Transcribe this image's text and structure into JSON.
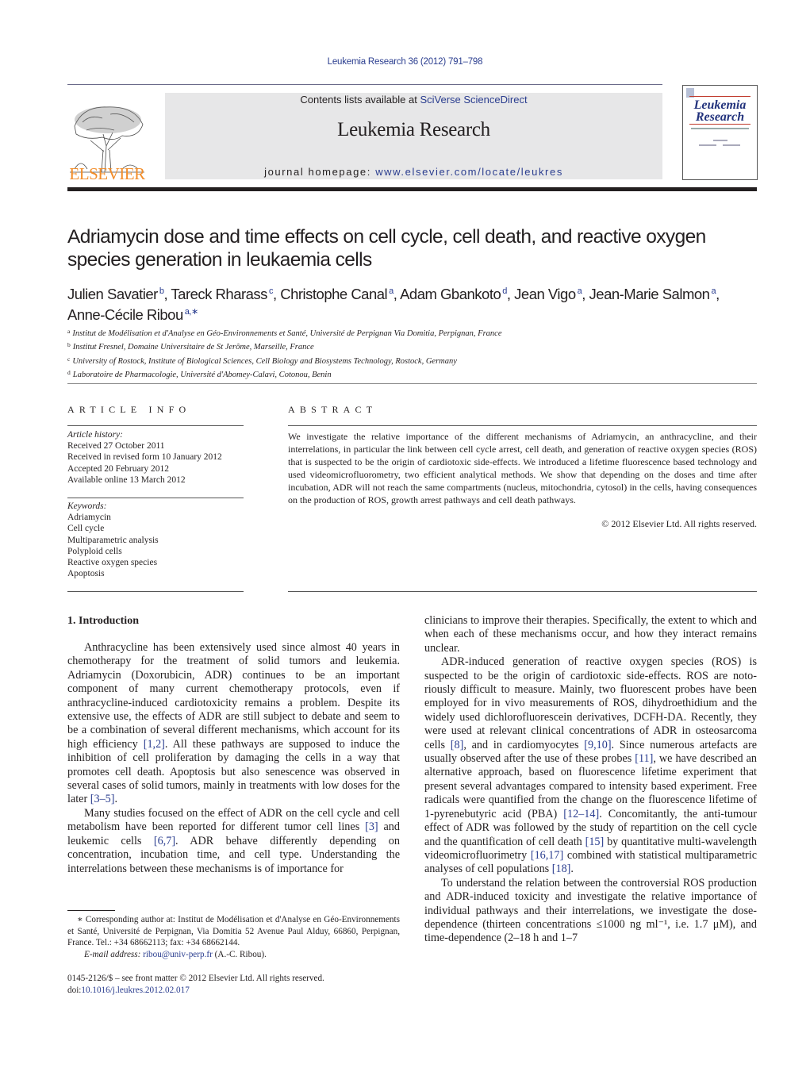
{
  "header": {
    "running_head": "Leukemia Research 36 (2012) 791–798",
    "contents_prefix": "Contents lists available at ",
    "contents_link": "SciVerse ScienceDirect",
    "journal_name": "Leukemia Research",
    "homepage_prefix": "journal homepage: ",
    "homepage_link": "www.elsevier.com/locate/leukres",
    "publisher_logo_text": "ELSEVIER",
    "cover_title_line1": "Leukemia",
    "cover_title_line2": "Research",
    "brand_color": "#f28c28",
    "link_color": "#2a3d8f"
  },
  "article": {
    "title": "Adriamycin dose and time effects on cell cycle, cell death, and reactive oxygen species generation in leukaemia cells",
    "authors": [
      {
        "name": "Julien Savatier",
        "aff": "b",
        "sep": ", "
      },
      {
        "name": "Tareck Rharass",
        "aff": "c",
        "sep": ", "
      },
      {
        "name": "Christophe Canal",
        "aff": "a",
        "sep": ", "
      },
      {
        "name": "Adam Gbankoto",
        "aff": "d",
        "sep": ", "
      },
      {
        "name": "Jean Vigo",
        "aff": "a",
        "sep": ", "
      },
      {
        "name": "Jean-Marie Salmon",
        "aff": "a",
        "sep": ","
      },
      {
        "name": "Anne-Cécile Ribou",
        "aff": "a,∗",
        "sep": ""
      }
    ],
    "affiliations": [
      {
        "key": "a",
        "text": "Institut de Modélisation et d'Analyse en Géo-Environnements et Santé, Université de Perpignan Via Domitia, Perpignan, France"
      },
      {
        "key": "b",
        "text": "Institut Fresnel, Domaine Universitaire de St Jerôme, Marseille, France"
      },
      {
        "key": "c",
        "text": "University of Rostock, Institute of Biological Sciences, Cell Biology and Biosystems Technology, Rostock, Germany"
      },
      {
        "key": "d",
        "text": "Laboratoire de Pharmacologie, Université d'Abomey-Calavi, Cotonou, Benin"
      }
    ]
  },
  "article_info": {
    "heading": "ARTICLE INFO",
    "history_label": "Article history:",
    "history": [
      "Received 27 October 2011",
      "Received in revised form 10 January 2012",
      "Accepted 20 February 2012",
      "Available online 13 March 2012"
    ],
    "keywords_label": "Keywords:",
    "keywords": [
      "Adriamycin",
      "Cell cycle",
      "Multiparametric analysis",
      "Polyploid cells",
      "Reactive oxygen species",
      "Apoptosis"
    ]
  },
  "abstract": {
    "heading": "ABSTRACT",
    "text": "We investigate the relative importance of the different mechanisms of Adriamycin, an anthracycline, and their interrelations, in particular the link between cell cycle arrest, cell death, and generation of reactive oxygen species (ROS) that is suspected to be the origin of cardiotoxic side-effects. We introduced a lifetime fluorescence based technology and used videomicrofluorometry, two efficient analytical methods. We show that depending on the doses and time after incubation, ADR will not reach the same compartments (nucleus, mitochondria, cytosol) in the cells, having consequences on the production of ROS, growth arrest pathways and cell death pathways.",
    "copyright": "© 2012 Elsevier Ltd. All rights reserved."
  },
  "body": {
    "section_heading": "1.  Introduction",
    "left_paragraphs": [
      [
        {
          "t": "Anthracycline has been extensively used since almost 40 years in chemotherapy for the treatment of solid tumors and leukemia. Adriamycin (Doxorubicin, ADR) continues to be an important component of many current chemotherapy protocols, even if anthracycline-induced cardiotoxicity remains a problem. Despite its extensive use, the effects of ADR are still subject to debate and seem to be a combination of several different mechanisms, which account for its high efficiency "
        },
        {
          "r": "[1,2]"
        },
        {
          "t": ". All these pathways are supposed to induce the inhibition of cell proliferation by damaging the cells in a way that promotes cell death. Apoptosis but also senescence was observed in several cases of solid tumors, mainly in treatments with low doses for the later "
        },
        {
          "r": "[3–5]"
        },
        {
          "t": "."
        }
      ],
      [
        {
          "t": "Many studies focused on the effect of ADR on the cell cycle and cell metabolism have been reported for different tumor cell lines "
        },
        {
          "r": "[3]"
        },
        {
          "t": " and leukemic cells "
        },
        {
          "r": "[6,7]"
        },
        {
          "t": ". ADR behave differently depend­ing on concentration, incubation time, and cell type. Understanding the interrelations between these mechanisms is of importance for"
        }
      ]
    ],
    "right_paragraphs": [
      [
        {
          "t": "clinicians to improve their therapies. Specifically, the extent to which and when each of these mechanisms occur, and how they interact remains unclear."
        }
      ],
      [
        {
          "t": "ADR-induced generation of reactive oxygen species (ROS) is suspected to be the origin of cardiotoxic side-effects. ROS are noto­riously difficult to measure. Mainly, two fluorescent probes have been employed for in vivo measurements of ROS, dihydroethid­ium and the widely used dichlorofluorescein derivatives, DCFH-DA. Recently, they were used at relevant clinical concentrations of ADR in osteosarcoma cells "
        },
        {
          "r": "[8]"
        },
        {
          "t": ", and in cardiomyocytes "
        },
        {
          "r": "[9,10]"
        },
        {
          "t": ". Since numerous artefacts are usually observed after the use of these probes "
        },
        {
          "r": "[11]"
        },
        {
          "t": ", we have described an alternative approach, based on fluorescence lifetime experiment that present several advan­tages compared to intensity based experiment. Free radicals were quantified from the change on the fluorescence lifetime of 1-pyrenebutyric acid (PBA) "
        },
        {
          "r": "[12–14]"
        },
        {
          "t": ". Concomitantly, the anti-tumour effect of ADR was followed by the study of repartition on the cell cycle and the quantification of cell death "
        },
        {
          "r": "[15]"
        },
        {
          "t": " by quantitative multi-wavelength videomicrofluorimetry "
        },
        {
          "r": "[16,17]"
        },
        {
          "t": " combined with statistical multiparametric analyses of cell populations "
        },
        {
          "r": "[18]"
        },
        {
          "t": "."
        }
      ],
      [
        {
          "t": "To understand the relation between the controversial ROS production and ADR-induced toxicity and investigate the rela­tive importance of individual pathways and their interrelations, we investigate the dose-dependence (thirteen concentrations ≤1000 ng ml⁻¹, i.e. 1.7 μM), and time-dependence (2–18 h and 1–7"
        }
      ]
    ]
  },
  "footnote": {
    "corresponding": "∗ Corresponding author at: Institut de Modélisation et d'Analyse en Géo-Environnements et Santé, Université de Perpignan, Via Domitia 52 Avenue Paul Alduy, 66860, Perpignan, France. Tel.: +34 68662113; fax: +34 68662144.",
    "email_label": "E-mail address: ",
    "email": "ribou@univ-perp.fr",
    "email_suffix": " (A.-C. Ribou).",
    "front_matter": "0145-2126/$ – see front matter © 2012 Elsevier Ltd. All rights reserved.",
    "doi_prefix": "doi:",
    "doi": "10.1016/j.leukres.2012.02.017"
  }
}
